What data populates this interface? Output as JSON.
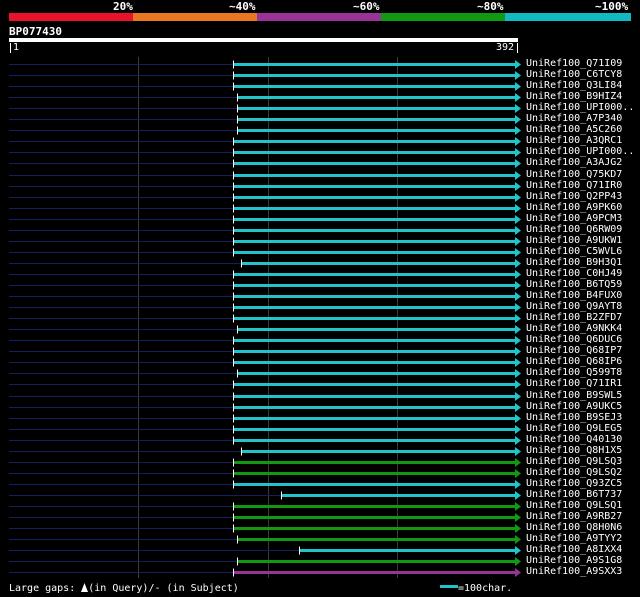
{
  "header": {
    "percent_labels": [
      "20%",
      "~40%",
      "~60%",
      "~80%",
      "~100%"
    ],
    "percent_colors": [
      "#e8132a",
      "#e87722",
      "#993399",
      "#119a11",
      "#11b9c4"
    ],
    "query_id": "BP077430",
    "query_start": "1",
    "query_end": "392"
  },
  "hits": [
    {
      "id": "UniRef100_Q71I09",
      "color": "#22c4cc",
      "start": 233
    },
    {
      "id": "UniRef100_C6TCY8",
      "color": "#22c4cc",
      "start": 233
    },
    {
      "id": "UniRef100_Q3LI84",
      "color": "#22c4cc",
      "start": 233
    },
    {
      "id": "UniRef100_B9HIZ4",
      "color": "#22c4cc",
      "start": 237
    },
    {
      "id": "UniRef100_UPI000..",
      "color": "#22c4cc",
      "start": 237
    },
    {
      "id": "UniRef100_A7P340",
      "color": "#22c4cc",
      "start": 237
    },
    {
      "id": "UniRef100_A5C260",
      "color": "#22c4cc",
      "start": 237
    },
    {
      "id": "UniRef100_A3QRC1",
      "color": "#22c4cc",
      "start": 233
    },
    {
      "id": "UniRef100_UPI000..",
      "color": "#22c4cc",
      "start": 233
    },
    {
      "id": "UniRef100_A3AJG2",
      "color": "#22c4cc",
      "start": 233
    },
    {
      "id": "UniRef100_Q75KD7",
      "color": "#22c4cc",
      "start": 233
    },
    {
      "id": "UniRef100_Q71IR0",
      "color": "#22c4cc",
      "start": 233
    },
    {
      "id": "UniRef100_Q2PP43",
      "color": "#22c4cc",
      "start": 233
    },
    {
      "id": "UniRef100_A9PK60",
      "color": "#22c4cc",
      "start": 233
    },
    {
      "id": "UniRef100_A9PCM3",
      "color": "#22c4cc",
      "start": 233
    },
    {
      "id": "UniRef100_Q6RW09",
      "color": "#22c4cc",
      "start": 233
    },
    {
      "id": "UniRef100_A9UKW1",
      "color": "#22c4cc",
      "start": 233
    },
    {
      "id": "UniRef100_C5WVL6",
      "color": "#22c4cc",
      "start": 233
    },
    {
      "id": "UniRef100_B9H3Q1",
      "color": "#22c4cc",
      "start": 241
    },
    {
      "id": "UniRef100_C0HJ49",
      "color": "#22c4cc",
      "start": 233
    },
    {
      "id": "UniRef100_B6TQ59",
      "color": "#22c4cc",
      "start": 233
    },
    {
      "id": "UniRef100_B4FUX0",
      "color": "#22c4cc",
      "start": 233
    },
    {
      "id": "UniRef100_Q9AYT8",
      "color": "#22c4cc",
      "start": 233
    },
    {
      "id": "UniRef100_B2ZFD7",
      "color": "#22c4cc",
      "start": 233
    },
    {
      "id": "UniRef100_A9NKK4",
      "color": "#22c4cc",
      "start": 237
    },
    {
      "id": "UniRef100_Q6DUC6",
      "color": "#22c4cc",
      "start": 233
    },
    {
      "id": "UniRef100_Q68IP7",
      "color": "#22c4cc",
      "start": 233
    },
    {
      "id": "UniRef100_Q68IP6",
      "color": "#22c4cc",
      "start": 233
    },
    {
      "id": "UniRef100_Q599T8",
      "color": "#22c4cc",
      "start": 237
    },
    {
      "id": "UniRef100_Q71IR1",
      "color": "#22c4cc",
      "start": 233
    },
    {
      "id": "UniRef100_B9SWL5",
      "color": "#22c4cc",
      "start": 233
    },
    {
      "id": "UniRef100_A9UKC5",
      "color": "#22c4cc",
      "start": 233
    },
    {
      "id": "UniRef100_B9SEJ3",
      "color": "#22c4cc",
      "start": 233
    },
    {
      "id": "UniRef100_Q9LEG5",
      "color": "#22c4cc",
      "start": 233
    },
    {
      "id": "UniRef100_Q40130",
      "color": "#22c4cc",
      "start": 233
    },
    {
      "id": "UniRef100_Q8H1X5",
      "color": "#22c4cc",
      "start": 241
    },
    {
      "id": "UniRef100_Q9LSQ3",
      "color": "#119a11",
      "start": 233
    },
    {
      "id": "UniRef100_Q9LSQ2",
      "color": "#119a11",
      "start": 233
    },
    {
      "id": "UniRef100_Q93ZC5",
      "color": "#22c4cc",
      "start": 233
    },
    {
      "id": "UniRef100_B6T737",
      "color": "#22c4cc",
      "start": 281
    },
    {
      "id": "UniRef100_Q9LSQ1",
      "color": "#119a11",
      "start": 233
    },
    {
      "id": "UniRef100_A9RB27",
      "color": "#119a11",
      "start": 233
    },
    {
      "id": "UniRef100_Q8H0N6",
      "color": "#119a11",
      "start": 233
    },
    {
      "id": "UniRef100_A9TYY2",
      "color": "#119a11",
      "start": 237
    },
    {
      "id": "UniRef100_A8IXX4",
      "color": "#22c4cc",
      "start": 299
    },
    {
      "id": "UniRef100_A9S1G8",
      "color": "#119a11",
      "start": 237
    },
    {
      "id": "UniRef100_A9SXX3",
      "color": "#993399",
      "start": 233
    }
  ],
  "legend": {
    "large_gaps": "Large gaps: ",
    "in_query": "(in Query)/",
    "in_subject": "- (in Subject)",
    "scale_text": "=100char."
  }
}
